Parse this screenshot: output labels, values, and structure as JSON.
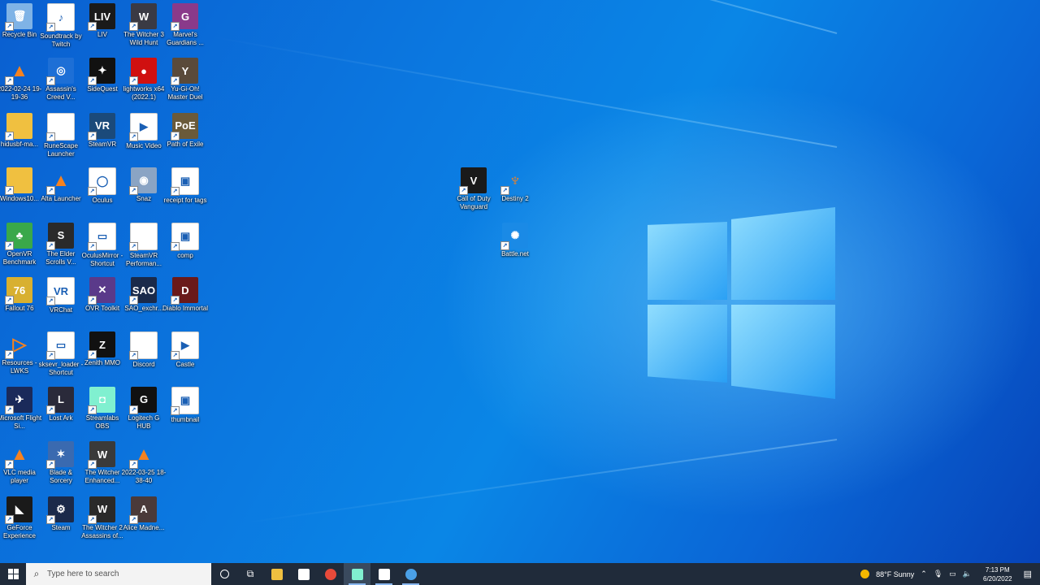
{
  "colors": {
    "taskbar": "#202b3a",
    "desktop_accent": "#0a78e0"
  },
  "desktop": {
    "icons": [
      {
        "label": "Recycle Bin",
        "icon": "recycle-bin-icon",
        "bg": "#7fb3e6",
        "glyph": "🗑"
      },
      {
        "label": "Soundtrack by Twitch",
        "icon": "twitch-soundtrack-icon",
        "bg": "#ffffff",
        "glyph": "♪"
      },
      {
        "label": "LIV",
        "icon": "liv-icon",
        "bg": "#1a1a1a",
        "glyph": "LIV"
      },
      {
        "label": "The Witcher 3 Wild Hunt",
        "icon": "witcher3-icon",
        "bg": "#3a3a44",
        "glyph": "W"
      },
      {
        "label": "Marvel's Guardians ...",
        "icon": "guardians-icon",
        "bg": "#8a3a8a",
        "glyph": "G"
      },
      {
        "label": "2022-02-24 19-19-36",
        "icon": "vlc-file-icon",
        "bg": "transparent",
        "glyph": "▲"
      },
      {
        "label": "Assassin's Creed V...",
        "icon": "uplay-icon",
        "bg": "#1d6fd6",
        "glyph": "◎"
      },
      {
        "label": "SideQuest",
        "icon": "sidequest-icon",
        "bg": "#111111",
        "glyph": "✦"
      },
      {
        "label": "lightworks x64 (2022.1)",
        "icon": "lightworks-icon",
        "bg": "#d01010",
        "glyph": "●"
      },
      {
        "label": "Yu-Gi-Oh! Master Duel",
        "icon": "yugioh-icon",
        "bg": "#5a4a3a",
        "glyph": "Y"
      },
      {
        "label": "hidusbf-ma...",
        "icon": "folder-icon",
        "bg": "#f0c040",
        "glyph": ""
      },
      {
        "label": "RuneScape Launcher",
        "icon": "file-icon",
        "bg": "#ffffff",
        "glyph": ""
      },
      {
        "label": "SteamVR",
        "icon": "steamvr-icon",
        "bg": "#1b4a7a",
        "glyph": "VR"
      },
      {
        "label": "Music Video",
        "icon": "video-file-icon",
        "bg": "#ffffff",
        "glyph": "▶"
      },
      {
        "label": "Path of Exile",
        "icon": "poe-icon",
        "bg": "#6a5a3a",
        "glyph": "PoE"
      },
      {
        "label": "Windows10...",
        "icon": "folder-icon",
        "bg": "#f0c040",
        "glyph": ""
      },
      {
        "label": "Alta Launcher",
        "icon": "alta-icon",
        "bg": "transparent",
        "glyph": "▲"
      },
      {
        "label": "Oculus",
        "icon": "oculus-icon",
        "bg": "#ffffff",
        "glyph": "◯"
      },
      {
        "label": "Snaz",
        "icon": "snaz-icon",
        "bg": "#8aa4c4",
        "glyph": "◉"
      },
      {
        "label": "receipt for tags",
        "icon": "image-file-icon",
        "bg": "#ffffff",
        "glyph": "▣"
      },
      {
        "label": "OpenVR Benchmark",
        "icon": "openvr-icon",
        "bg": "#3aa84a",
        "glyph": "♣"
      },
      {
        "label": "The Elder Scrolls V...",
        "icon": "skyrim-icon",
        "bg": "#2a2a2a",
        "glyph": "S"
      },
      {
        "label": "OculusMirror - Shortcut",
        "icon": "oculusmirror-icon",
        "bg": "#ffffff",
        "glyph": "▭"
      },
      {
        "label": "SteamVR Performan...",
        "icon": "file-icon",
        "bg": "#ffffff",
        "glyph": ""
      },
      {
        "label": "comp",
        "icon": "image-file-icon",
        "bg": "#ffffff",
        "glyph": "▣"
      },
      {
        "label": "Fallout 76",
        "icon": "fallout76-icon",
        "bg": "#d8b030",
        "glyph": "76"
      },
      {
        "label": "VRChat",
        "icon": "vrchat-icon",
        "bg": "#ffffff",
        "glyph": "VR"
      },
      {
        "label": "OVR Toolkit",
        "icon": "ovrtoolkit-icon",
        "bg": "#5a3a8a",
        "glyph": "✕"
      },
      {
        "label": "SAO_exchr...",
        "icon": "sao-icon",
        "bg": "#1a2a4a",
        "glyph": "SAO"
      },
      {
        "label": "Diablo Immortal",
        "icon": "diablo-icon",
        "bg": "#6a1a1a",
        "glyph": "D"
      },
      {
        "label": "Resources - LWKS",
        "icon": "resources-icon",
        "bg": "transparent",
        "glyph": "▷"
      },
      {
        "label": "sksevr_loader - Shortcut",
        "icon": "shortcut-window-icon",
        "bg": "#ffffff",
        "glyph": "▭"
      },
      {
        "label": "Zenith MMO",
        "icon": "zenith-icon",
        "bg": "#111111",
        "glyph": "Z"
      },
      {
        "label": "Discord",
        "icon": "file-icon",
        "bg": "#ffffff",
        "glyph": ""
      },
      {
        "label": "Castle",
        "icon": "video-file-icon",
        "bg": "#ffffff",
        "glyph": "▶"
      },
      {
        "label": "Microsoft Flight Si...",
        "icon": "flightsim-icon",
        "bg": "#1a2a5a",
        "glyph": "✈"
      },
      {
        "label": "Lost Ark",
        "icon": "lostark-icon",
        "bg": "#2a2a3a",
        "glyph": "L"
      },
      {
        "label": "Streamlabs OBS",
        "icon": "streamlabs-icon",
        "bg": "#80f0d0",
        "glyph": "◘"
      },
      {
        "label": "Logitech G HUB",
        "icon": "logitech-icon",
        "bg": "#111111",
        "glyph": "G"
      },
      {
        "label": "thumbnail",
        "icon": "image-file-icon",
        "bg": "#ffffff",
        "glyph": "▣"
      },
      {
        "label": "VLC media player",
        "icon": "vlc-icon",
        "bg": "transparent",
        "glyph": "▲"
      },
      {
        "label": "Blade & Sorcery",
        "icon": "blade-sorcery-icon",
        "bg": "#3a6ab0",
        "glyph": "✶"
      },
      {
        "label": "The Witcher Enhanced...",
        "icon": "witcher-icon",
        "bg": "#3a3a3a",
        "glyph": "W"
      },
      {
        "label": "2022-03-25 18-38-40",
        "icon": "vlc-file-icon",
        "bg": "transparent",
        "glyph": "▲"
      },
      {
        "label": "",
        "icon": "empty-slot",
        "bg": "transparent",
        "glyph": ""
      },
      {
        "label": "GeForce Experience",
        "icon": "geforce-icon",
        "bg": "#1a1a1a",
        "glyph": "◣"
      },
      {
        "label": "Steam",
        "icon": "steam-icon",
        "bg": "#1b2a4a",
        "glyph": "⚙"
      },
      {
        "label": "The Witcher 2 Assassins of...",
        "icon": "witcher2-icon",
        "bg": "#2a2a2a",
        "glyph": "W"
      },
      {
        "label": "Alice Madne...",
        "icon": "alice-icon",
        "bg": "#4a3a3a",
        "glyph": "A"
      }
    ],
    "center_icons": [
      {
        "label": "Call of Duty Vanguard",
        "icon": "cod-vanguard-icon",
        "bg": "#1a1a1a",
        "glyph": "V"
      },
      {
        "label": "Destiny 2",
        "icon": "destiny2-icon",
        "bg": "transparent",
        "glyph": "♆"
      },
      {
        "label": "Battle.net",
        "icon": "battlenet-icon",
        "bg": "#1a8ae6",
        "glyph": "✺"
      }
    ]
  },
  "taskbar": {
    "search_placeholder": "Type here to search",
    "apps": [
      {
        "name": "file-explorer",
        "icon": "folder-icon",
        "color": "#f0c040",
        "state": "normal"
      },
      {
        "name": "store",
        "icon": "store-icon",
        "color": "#ffffff",
        "state": "normal"
      },
      {
        "name": "chrome",
        "icon": "chrome-icon",
        "color": "#e84a3a",
        "state": "normal"
      },
      {
        "name": "streamlabs",
        "icon": "streamlabs-icon",
        "color": "#80f0d0",
        "state": "active"
      },
      {
        "name": "oculus",
        "icon": "oculus-icon",
        "color": "#ffffff",
        "state": "running"
      },
      {
        "name": "battlenet",
        "icon": "battlenet-icon",
        "color": "#4aa0e6",
        "state": "running"
      }
    ],
    "weather": "88°F  Sunny",
    "time": "7:13 PM",
    "date": "6/20/2022"
  }
}
